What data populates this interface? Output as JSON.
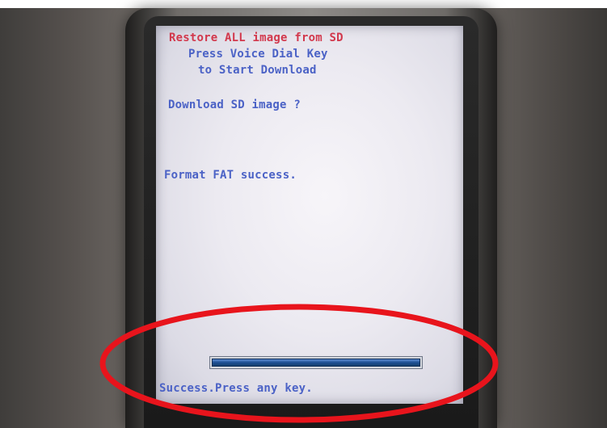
{
  "screen": {
    "title": "Restore ALL image from SD",
    "instruction_line1": "Press Voice Dial Key",
    "instruction_line2": "to Start Download",
    "question": "Download SD image ?",
    "format_status": "Format FAT success.",
    "completion_status": "Success.Press any key."
  },
  "progress": {
    "fraction": 1.0
  },
  "colors": {
    "title_text": "#d2384c",
    "body_text": "#4b62c6",
    "progress_fill": "#1d4e93",
    "annotation_ellipse": "#e8141c"
  },
  "icons": {
    "annotation": "red-highlight-ellipse"
  }
}
